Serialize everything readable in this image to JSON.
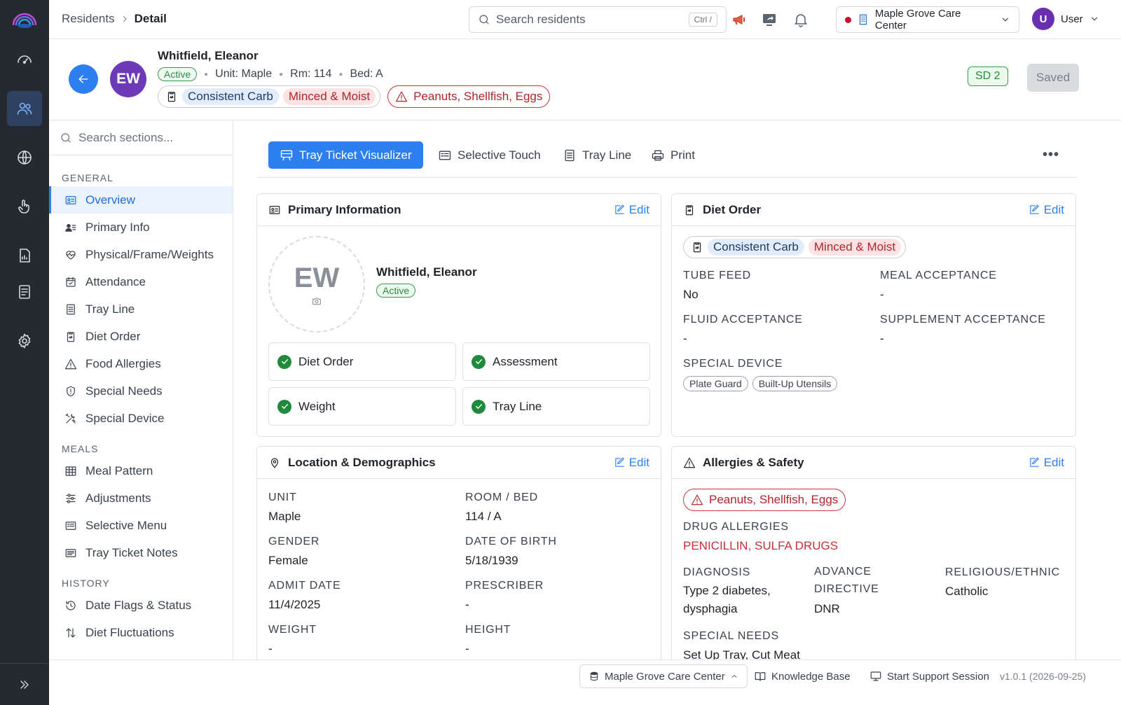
{
  "breadcrumb": {
    "parent": "Residents",
    "current": "Detail"
  },
  "search": {
    "placeholder": "Search residents",
    "shortcut": "Ctrl /"
  },
  "facility": {
    "name": "Maple Grove Care Center"
  },
  "user": {
    "initial": "U",
    "name": "User"
  },
  "resident": {
    "initials": "EW",
    "name": "Whitfield, Eleanor",
    "status": "Active",
    "unit": "Unit: Maple",
    "room": "Rm: 114",
    "bed": "Bed: A",
    "diet_texture": "Consistent Carb",
    "diet_consistency": "Minced & Moist",
    "allergies": "Peanuts, Shellfish, Eggs"
  },
  "header": {
    "sd_badge": "SD 2",
    "saved_label": "Saved"
  },
  "sections": {
    "search_placeholder": "Search sections...",
    "general_label": "GENERAL",
    "general": [
      "Overview",
      "Primary Info",
      "Physical/Frame/Weights",
      "Attendance",
      "Tray Line",
      "Diet Order",
      "Food Allergies",
      "Special Needs",
      "Special Device"
    ],
    "meals_label": "MEALS",
    "meals": [
      "Meal Pattern",
      "Adjustments",
      "Selective Menu",
      "Tray Ticket Notes"
    ],
    "history_label": "HISTORY",
    "history": [
      "Date Flags & Status",
      "Diet Fluctuations"
    ]
  },
  "toolbar": {
    "tray_ticket": "Tray Ticket Visualizer",
    "selective_touch": "Selective Touch",
    "tray_line": "Tray Line",
    "print": "Print",
    "more": "•••"
  },
  "edit_label": "Edit",
  "primary_info": {
    "title": "Primary Information",
    "tiles": [
      "Diet Order",
      "Assessment",
      "Weight",
      "Tray Line"
    ]
  },
  "diet_order": {
    "title": "Diet Order",
    "tube_feed_label": "TUBE FEED",
    "tube_feed": "No",
    "meal_acceptance_label": "MEAL ACCEPTANCE",
    "meal_acceptance": "-",
    "fluid_acceptance_label": "FLUID ACCEPTANCE",
    "fluid_acceptance": "-",
    "supplement_acceptance_label": "SUPPLEMENT ACCEPTANCE",
    "supplement_acceptance": "-",
    "special_device_label": "SPECIAL DEVICE",
    "devices": [
      "Plate Guard",
      "Built-Up Utensils"
    ]
  },
  "location": {
    "title": "Location & Demographics",
    "unit_label": "UNIT",
    "unit": "Maple",
    "room_label": "ROOM / BED",
    "room": "114 / A",
    "gender_label": "GENDER",
    "gender": "Female",
    "dob_label": "DATE OF BIRTH",
    "dob": "5/18/1939",
    "admit_label": "ADMIT DATE",
    "admit": "11/4/2025",
    "prescriber_label": "PRESCRIBER",
    "prescriber": "-",
    "weight_label": "WEIGHT",
    "weight": "-",
    "height_label": "HEIGHT",
    "height": "-"
  },
  "allergies_safety": {
    "title": "Allergies & Safety",
    "drug_label": "DRUG ALLERGIES",
    "drug": "PENICILLIN, SULFA DRUGS",
    "diagnosis_label": "DIAGNOSIS",
    "diagnosis": "Type 2 diabetes, dysphagia",
    "advance_label": "ADVANCE DIRECTIVE",
    "advance": "DNR",
    "religious_label": "RELIGIOUS/ETHNIC",
    "religious": "Catholic",
    "special_needs_label": "SPECIAL NEEDS",
    "special_needs": "Set Up Tray, Cut Meat"
  },
  "footer": {
    "facility": "Maple Grove Care Center",
    "knowledge": "Knowledge Base",
    "support": "Start Support Session",
    "version": "v1.0.1 (2026-09-25)"
  },
  "colors": {
    "accent": "#2d7ff0",
    "rail": "#252a31",
    "danger": "#c62f37",
    "success": "#1f8a3c"
  }
}
